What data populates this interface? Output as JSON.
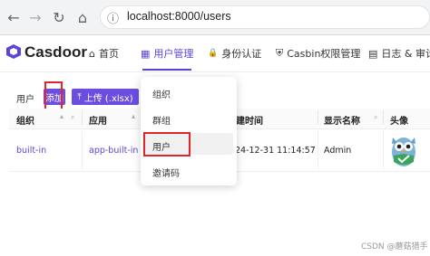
{
  "browser": {
    "url": "localhost:8000/users",
    "back_icon": "←",
    "forward_icon": "→",
    "reload_icon": "↻",
    "home_icon": "⌂",
    "info_icon": "ⓘ"
  },
  "app": {
    "brand": "Casdoor",
    "nav": [
      {
        "label": "首页",
        "icon": "⌂"
      },
      {
        "label": "用户管理",
        "icon": "▦"
      },
      {
        "label": "身份认证",
        "icon": "🔒"
      },
      {
        "label": "Casbin权限管理",
        "icon": "⛨"
      },
      {
        "label": "日志 & 审计",
        "icon": "▤"
      }
    ]
  },
  "toolbar": {
    "label": "用户",
    "add_label": "添加",
    "upload_label": "上传 (.xlsx)",
    "upload_icon": "⤒"
  },
  "table": {
    "headers": [
      "组织",
      "应用",
      "建时间",
      "显示名称",
      "头像"
    ],
    "row": {
      "org": "built-in",
      "app": "app-built-in",
      "time": "24-12-31 11:14:57",
      "display_name": "Admin"
    }
  },
  "dropdown": {
    "items": [
      "组织",
      "群组",
      "用户",
      "邀请码"
    ]
  },
  "watermark": "CSDN @蘑菇猎手",
  "colors": {
    "accent": "#5b44d6",
    "highlight": "#e0262b"
  }
}
